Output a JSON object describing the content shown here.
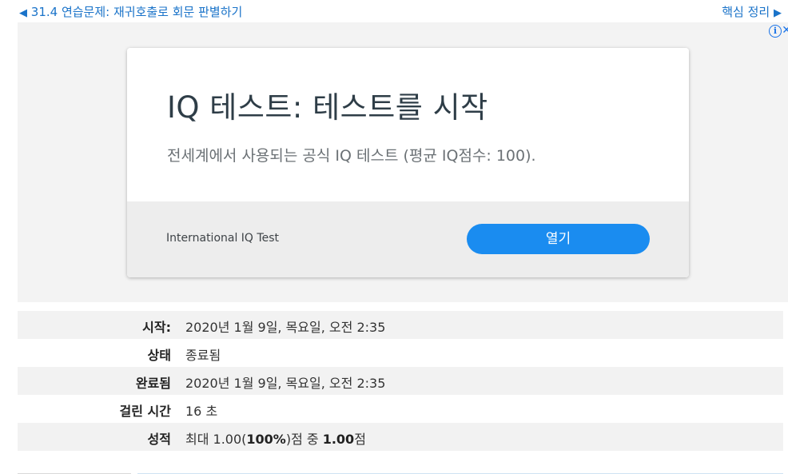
{
  "nav": {
    "prev_arrow": "◀",
    "prev_label": "31.4 연습문제: 재귀호출로 회문 판별하기",
    "next_label": "핵심 정리",
    "next_arrow": "▶"
  },
  "ad": {
    "adchoices_icon": "i",
    "close_icon": "✕",
    "title": "IQ 테스트: 테스트를 시작",
    "description": "전세계에서 사용되는 공식 IQ 테스트 (평균 IQ점수: 100).",
    "advertiser": "International IQ Test",
    "cta_label": "열기",
    "cta_color": "#1a8cf0"
  },
  "summary": {
    "rows": [
      {
        "label": "시작:",
        "value": "2020년 1월 9일, 목요일, 오전 2:35"
      },
      {
        "label": "상태",
        "value": "종료됨"
      },
      {
        "label": "완료됨",
        "value": "2020년 1월 9일, 목요일, 오전 2:35"
      },
      {
        "label": "걸린 시간",
        "value": "16 초"
      },
      {
        "label": "성적",
        "value_parts": {
          "p1": "최대 1.00(",
          "p2": "100%",
          "p3": ")점 중 ",
          "p4": "1.00",
          "p5": "점"
        }
      }
    ]
  },
  "colors": {
    "link": "#1a73c9",
    "stripe": "#f2f2f2",
    "ad_background": "#f3f3f3"
  }
}
